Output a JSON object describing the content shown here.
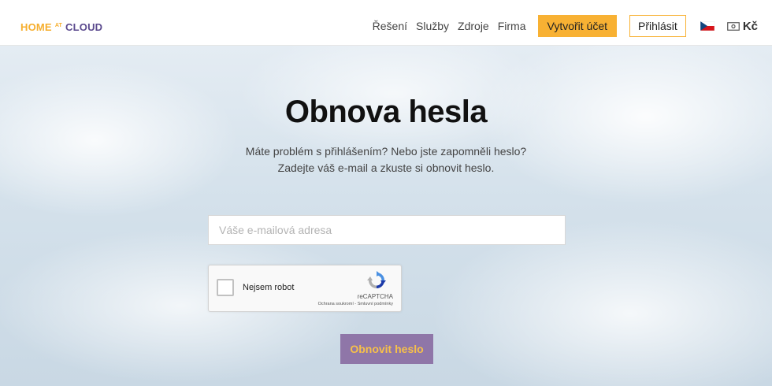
{
  "header": {
    "logo": {
      "word1": "HOME",
      "at": "AT",
      "word2": "CLOUD"
    },
    "nav": {
      "items": [
        "Řešení",
        "Služby",
        "Zdroje",
        "Firma"
      ],
      "signup_label": "Vytvořit účet",
      "login_label": "Přihlásit",
      "language_icon": "czech-flag-icon",
      "currency_icon": "banknote-icon",
      "currency_label": "Kč"
    }
  },
  "main": {
    "title": "Obnova hesla",
    "subtitle_line1": "Máte problém s přihlášením? Nebo jste zapomněli heslo?",
    "subtitle_line2": "Zadejte váš e-mail a zkuste si obnovit heslo.",
    "email_placeholder": "Váše e-mailová adresa",
    "email_value": "",
    "captcha": {
      "label": "Nejsem robot",
      "brand": "reCAPTCHA",
      "privacy_link": "Ochrana soukromí",
      "separator": " - ",
      "terms_link": "Smluvní podmínky",
      "logo_icon": "recaptcha-logo-icon"
    },
    "submit_label": "Obnovit heslo"
  },
  "colors": {
    "accent_yellow": "#f8b133",
    "brand_purple": "#5b4a8e",
    "button_purple": "#8f76a8",
    "button_text": "#f6c04a"
  }
}
